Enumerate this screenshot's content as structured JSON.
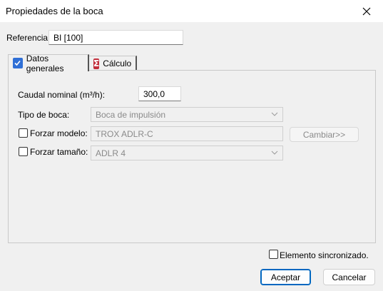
{
  "window": {
    "title": "Propiedades de la boca"
  },
  "reference": {
    "label": "Referencia:",
    "value": "BI [100]"
  },
  "tabs": [
    {
      "label": "Datos generales",
      "icon": "checkbox-icon",
      "active": true
    },
    {
      "label": "Cálculo",
      "icon": "sigma-icon",
      "active": false
    }
  ],
  "general": {
    "caudal_label": "Caudal nominal (m³/h):",
    "caudal_value": "300,0",
    "tipo_label": "Tipo de boca:",
    "tipo_value": "Boca de impulsión",
    "forzar_modelo_label": "Forzar modelo:",
    "modelo_value": "TROX ADLR-C",
    "cambiar_label": "Cambiar>>",
    "forzar_tamano_label": "Forzar tamaño:",
    "tamano_value": "ADLR 4"
  },
  "footer": {
    "sync_label": "Elemento sincronizado.",
    "accept_label": "Aceptar",
    "cancel_label": "Cancelar"
  },
  "colors": {
    "accent": "#0067c0",
    "tab_check": "#2f6fd6",
    "tab_sigma": "#c22d3a"
  }
}
